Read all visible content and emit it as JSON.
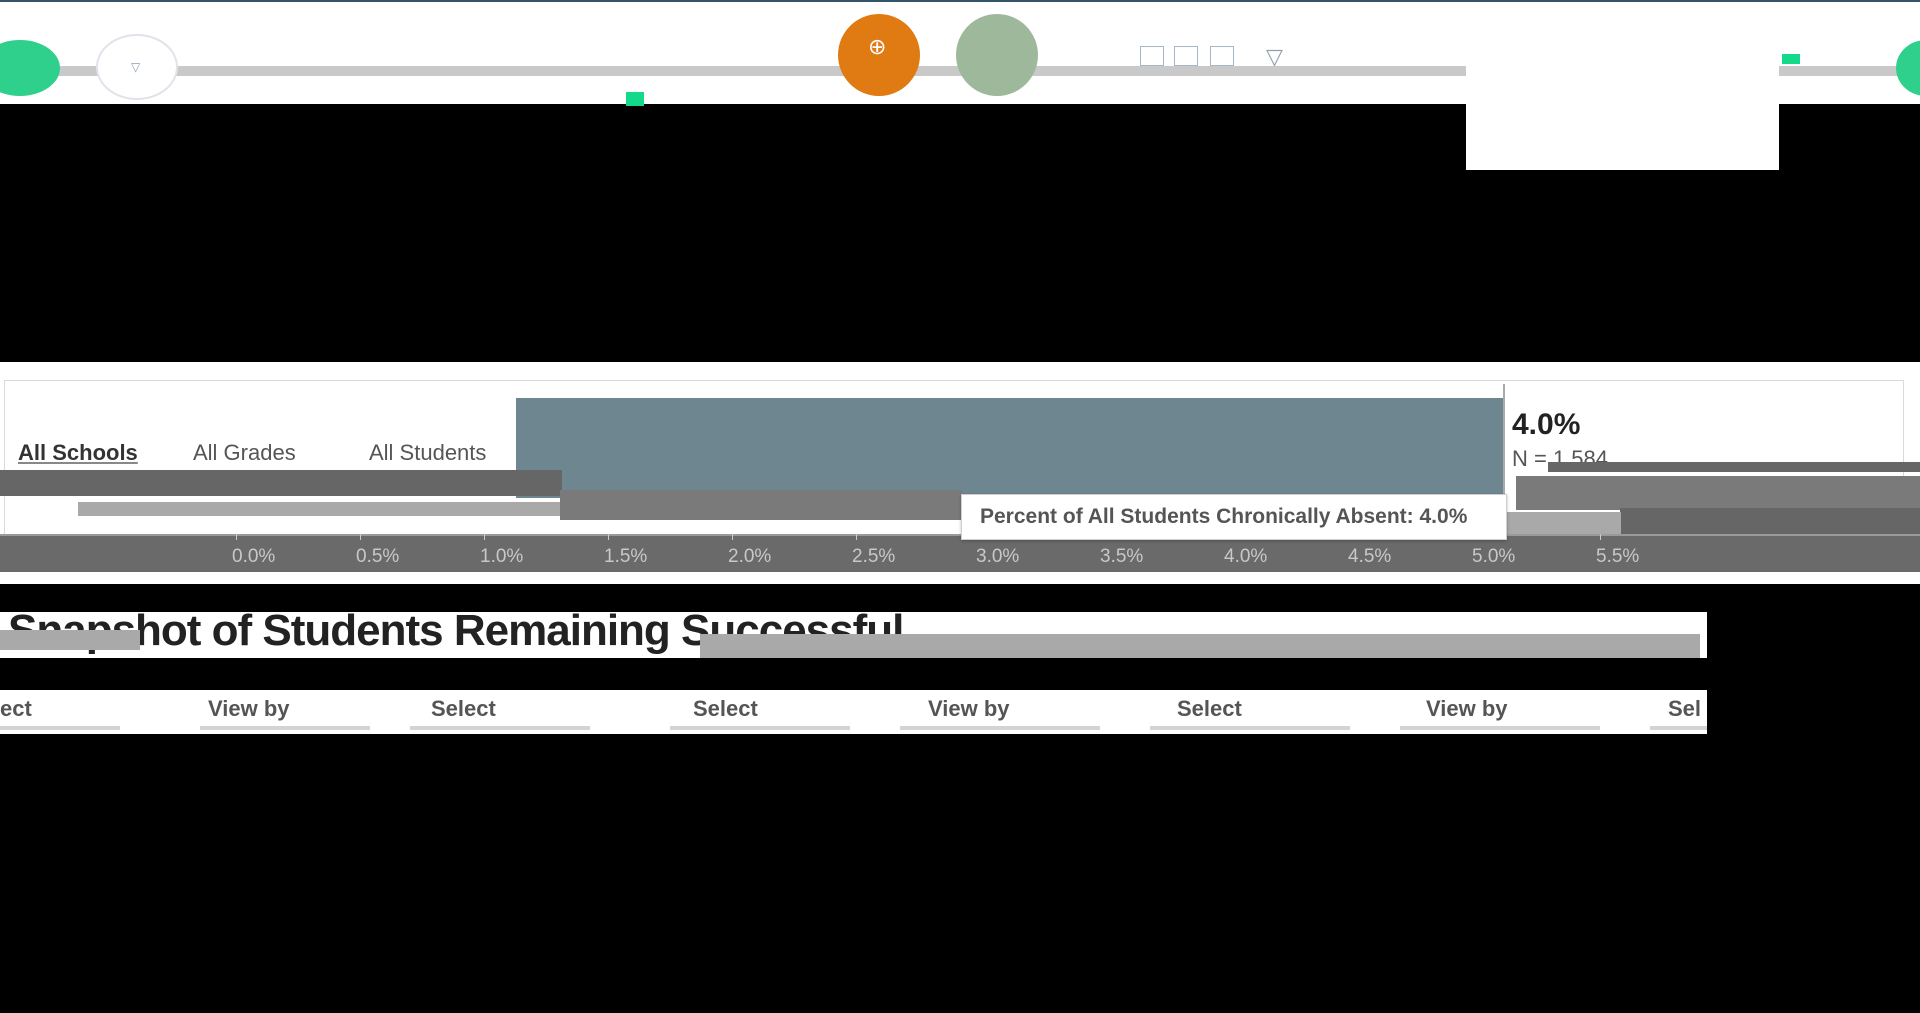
{
  "filters": {
    "schools": "All Schools",
    "grades": "All Grades",
    "students": "All Students"
  },
  "chart_data": {
    "type": "bar",
    "orientation": "horizontal",
    "categories": [
      "All Students"
    ],
    "values": [
      4.0
    ],
    "value_label": "4.0%",
    "n_label": "N = 1,584",
    "tooltip": "Percent of All Students Chronically Absent: 4.0%",
    "x_ticks": [
      "0.0%",
      "0.5%",
      "1.0%",
      "1.5%",
      "2.0%",
      "2.5%",
      "3.0%",
      "3.5%",
      "4.0%",
      "4.5%",
      "5.0%",
      "5.5%"
    ],
    "xlim": [
      0,
      5.5
    ],
    "bar_color": "#6e8690"
  },
  "heading": "Snapshot of Students Remaining Successful",
  "control_labels": [
    "ect",
    "View by",
    "Select",
    "Select",
    "View by",
    "Select",
    "View by",
    "Sel"
  ],
  "colors": {
    "accent_orange": "#e07a12",
    "accent_green": "#14d98b",
    "accent_sage": "#9eb89c"
  },
  "icons": [
    "globe-icon",
    "user-icon",
    "funnel-icon",
    "table-icon"
  ]
}
